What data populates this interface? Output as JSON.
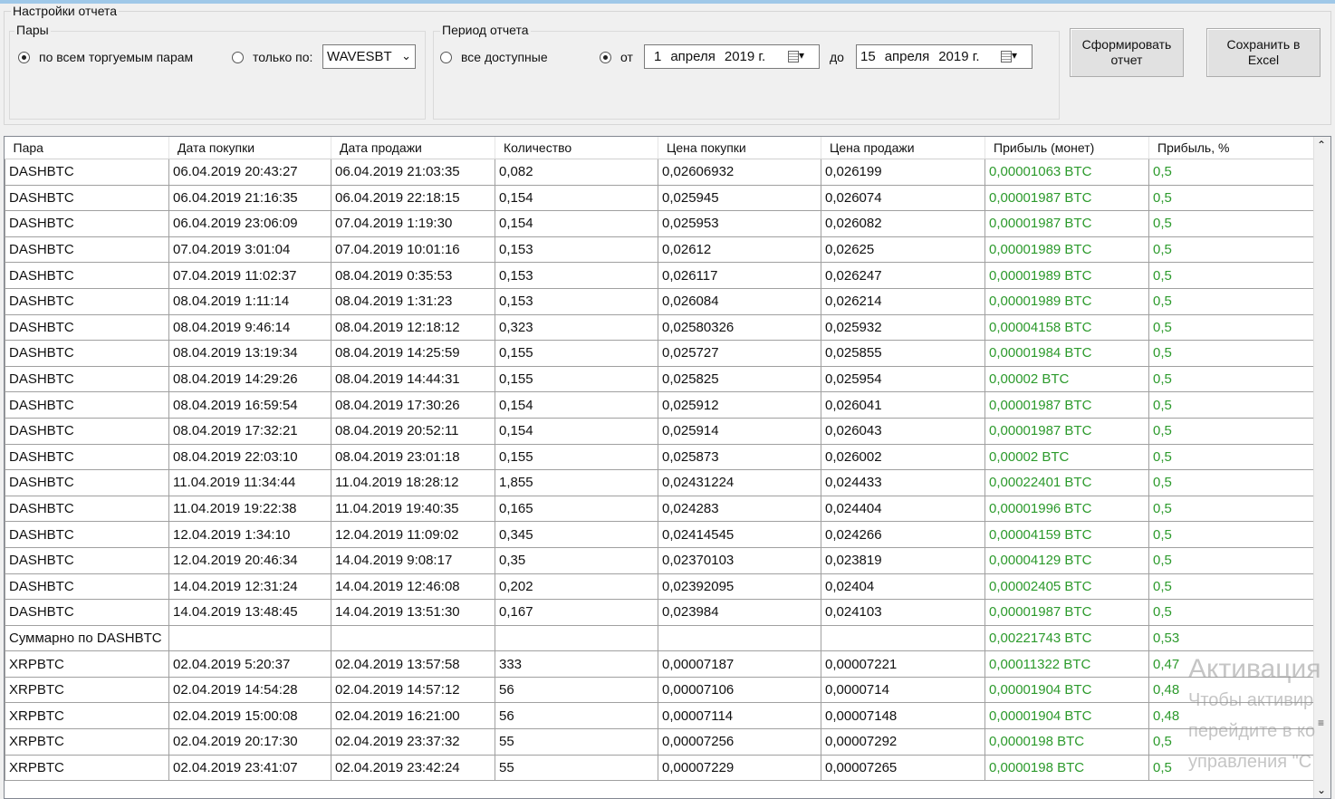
{
  "settings": {
    "title": "Настройки отчета",
    "pairs_group": {
      "label": "Пары",
      "option_all": "по всем торгуемым парам",
      "option_only": "только по:",
      "only_value": "WAVESBT"
    },
    "period_group": {
      "label": "Период отчета",
      "option_all": "все доступные",
      "option_from": "от",
      "from_date": {
        "day": "1",
        "month": "апреля",
        "year": "2019 г."
      },
      "to_label": "до",
      "to_date": {
        "day": "15",
        "month": "апреля",
        "year": "2019 г."
      }
    },
    "buttons": {
      "generate": "Сформировать отчет",
      "save_excel": "Сохранить в Excel"
    }
  },
  "table": {
    "columns": [
      "Пара",
      "Дата покупки",
      "Дата продажи",
      "Количество",
      "Цена покупки",
      "Цена продажи",
      "Прибыль (монет)",
      "Прибыль, %"
    ],
    "rows": [
      [
        "DASHBTC",
        "06.04.2019 20:43:27",
        "06.04.2019 21:03:35",
        "0,082",
        "0,02606932",
        "0,026199",
        "0,00001063 BTC",
        "0,5"
      ],
      [
        "DASHBTC",
        "06.04.2019 21:16:35",
        "06.04.2019 22:18:15",
        "0,154",
        "0,025945",
        "0,026074",
        "0,00001987 BTC",
        "0,5"
      ],
      [
        "DASHBTC",
        "06.04.2019 23:06:09",
        "07.04.2019 1:19:30",
        "0,154",
        "0,025953",
        "0,026082",
        "0,00001987 BTC",
        "0,5"
      ],
      [
        "DASHBTC",
        "07.04.2019 3:01:04",
        "07.04.2019 10:01:16",
        "0,153",
        "0,02612",
        "0,02625",
        "0,00001989 BTC",
        "0,5"
      ],
      [
        "DASHBTC",
        "07.04.2019 11:02:37",
        "08.04.2019 0:35:53",
        "0,153",
        "0,026117",
        "0,026247",
        "0,00001989 BTC",
        "0,5"
      ],
      [
        "DASHBTC",
        "08.04.2019 1:11:14",
        "08.04.2019 1:31:23",
        "0,153",
        "0,026084",
        "0,026214",
        "0,00001989 BTC",
        "0,5"
      ],
      [
        "DASHBTC",
        "08.04.2019 9:46:14",
        "08.04.2019 12:18:12",
        "0,323",
        "0,02580326",
        "0,025932",
        "0,00004158 BTC",
        "0,5"
      ],
      [
        "DASHBTC",
        "08.04.2019 13:19:34",
        "08.04.2019 14:25:59",
        "0,155",
        "0,025727",
        "0,025855",
        "0,00001984 BTC",
        "0,5"
      ],
      [
        "DASHBTC",
        "08.04.2019 14:29:26",
        "08.04.2019 14:44:31",
        "0,155",
        "0,025825",
        "0,025954",
        "0,00002 BTC",
        "0,5"
      ],
      [
        "DASHBTC",
        "08.04.2019 16:59:54",
        "08.04.2019 17:30:26",
        "0,154",
        "0,025912",
        "0,026041",
        "0,00001987 BTC",
        "0,5"
      ],
      [
        "DASHBTC",
        "08.04.2019 17:32:21",
        "08.04.2019 20:52:11",
        "0,154",
        "0,025914",
        "0,026043",
        "0,00001987 BTC",
        "0,5"
      ],
      [
        "DASHBTC",
        "08.04.2019 22:03:10",
        "08.04.2019 23:01:18",
        "0,155",
        "0,025873",
        "0,026002",
        "0,00002 BTC",
        "0,5"
      ],
      [
        "DASHBTC",
        "11.04.2019 11:34:44",
        "11.04.2019 18:28:12",
        "1,855",
        "0,02431224",
        "0,024433",
        "0,00022401 BTC",
        "0,5"
      ],
      [
        "DASHBTC",
        "11.04.2019 19:22:38",
        "11.04.2019 19:40:35",
        "0,165",
        "0,024283",
        "0,024404",
        "0,00001996 BTC",
        "0,5"
      ],
      [
        "DASHBTC",
        "12.04.2019 1:34:10",
        "12.04.2019 11:09:02",
        "0,345",
        "0,02414545",
        "0,024266",
        "0,00004159 BTC",
        "0,5"
      ],
      [
        "DASHBTC",
        "12.04.2019 20:46:34",
        "14.04.2019 9:08:17",
        "0,35",
        "0,02370103",
        "0,023819",
        "0,00004129 BTC",
        "0,5"
      ],
      [
        "DASHBTC",
        "14.04.2019 12:31:24",
        "14.04.2019 12:46:08",
        "0,202",
        "0,02392095",
        "0,02404",
        "0,00002405 BTC",
        "0,5"
      ],
      [
        "DASHBTC",
        "14.04.2019 13:48:45",
        "14.04.2019 13:51:30",
        "0,167",
        "0,023984",
        "0,024103",
        "0,00001987 BTC",
        "0,5"
      ],
      [
        "Суммарно по DASHBTC",
        "",
        "",
        "",
        "",
        "",
        "0,00221743 BTC",
        "0,53"
      ],
      [
        "XRPBTC",
        "02.04.2019 5:20:37",
        "02.04.2019 13:57:58",
        "333",
        "0,00007187",
        "0,00007221",
        "0,00011322 BTC",
        "0,47"
      ],
      [
        "XRPBTC",
        "02.04.2019 14:54:28",
        "02.04.2019 14:57:12",
        "56",
        "0,00007106",
        "0,0000714",
        "0,00001904 BTC",
        "0,48"
      ],
      [
        "XRPBTC",
        "02.04.2019 15:00:08",
        "02.04.2019 16:21:00",
        "56",
        "0,00007114",
        "0,00007148",
        "0,00001904 BTC",
        "0,48"
      ],
      [
        "XRPBTC",
        "02.04.2019 20:17:30",
        "02.04.2019 23:37:32",
        "55",
        "0,00007256",
        "0,00007292",
        "0,0000198 BTC",
        "0,5"
      ],
      [
        "XRPBTC",
        "02.04.2019 23:41:07",
        "02.04.2019 23:42:24",
        "55",
        "0,00007229",
        "0,00007265",
        "0,0000198 BTC",
        "0,5"
      ]
    ]
  },
  "watermark": {
    "line1": "Активация",
    "line2": "Чтобы активир",
    "line3": "перейдите в ко",
    "line4": "управления \"С"
  },
  "colors": {
    "profit_green": "#2c9a2c",
    "accent_line": "#9fc8e8"
  }
}
